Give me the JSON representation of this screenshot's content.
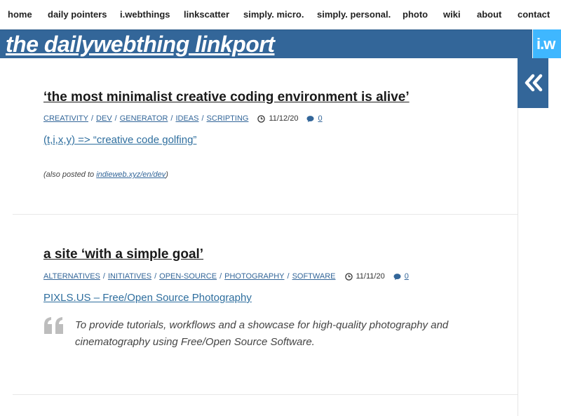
{
  "nav": {
    "items": [
      "home",
      "daily pointers",
      "i.webthings",
      "linkscatter",
      "simply. micro.",
      "simply. personal.",
      "photo",
      "wiki",
      "about",
      "contact"
    ]
  },
  "banner": {
    "title": "the dailywebthing linkport",
    "logo_text": "i.w",
    "logo_color": "#3fb7ff",
    "bar_color": "#336699"
  },
  "sidebar": {
    "toggle_icon": "double-chevron-left-icon"
  },
  "posts": [
    {
      "title": "‘the most minimalist creative coding environment is alive’",
      "categories": [
        "CREATIVITY",
        "DEV",
        "GENERATOR",
        "IDEAS",
        "SCRIPTING"
      ],
      "date": "11/12/20",
      "comments": "0",
      "link_text": "(t,i,x,y) => “creative code golfing”",
      "also_prefix": "(also posted to ",
      "also_link": "indieweb.xyz/en/dev",
      "also_suffix": ")"
    },
    {
      "title": "a site ‘with a simple goal’",
      "categories": [
        "ALTERNATIVES",
        "INITIATIVES",
        "OPEN-SOURCE",
        "PHOTOGRAPHY",
        "SOFTWARE"
      ],
      "date": "11/11/20",
      "comments": "0",
      "link_text": "PIXLS.US – Free/Open Source Photography",
      "quote_line1": "To provide tutorials, workflows and a showcase for high-quality photography and",
      "quote_line2": "cinematography using Free/Open Source Software."
    }
  ]
}
